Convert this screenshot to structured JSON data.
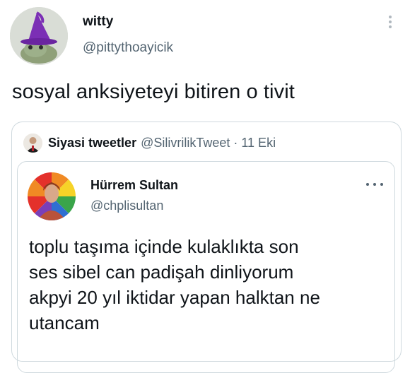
{
  "tweet": {
    "author": {
      "display_name": "witty",
      "handle": "@pittythoayicik",
      "avatar_icon": "witch-hat-frog-avatar"
    },
    "text": "sosyal anksiyeteyi bitiren o tivit",
    "more_icon": "vertical-more-icon"
  },
  "quote": {
    "author": {
      "display_name": "Siyasi tweetler",
      "handle": "@SilivrilikTweet",
      "avatar_icon": "person-avatar"
    },
    "separator": "·",
    "date": "11 Eki",
    "inner_tweet": {
      "author": {
        "display_name": "Hürrem Sultan",
        "handle": "@chplisultan",
        "avatar_icon": "rainbow-portrait-avatar"
      },
      "more_icon": "horizontal-more-icon",
      "lines": [
        "toplu taşıma içinde kulaklıkta son",
        "ses sibel can padişah dinliyorum",
        "akpyi 20 yıl iktidar yapan halktan ne",
        "utancam"
      ]
    }
  },
  "colors": {
    "text": "#0f1419",
    "secondary": "#536471",
    "border": "#cfd9de"
  }
}
